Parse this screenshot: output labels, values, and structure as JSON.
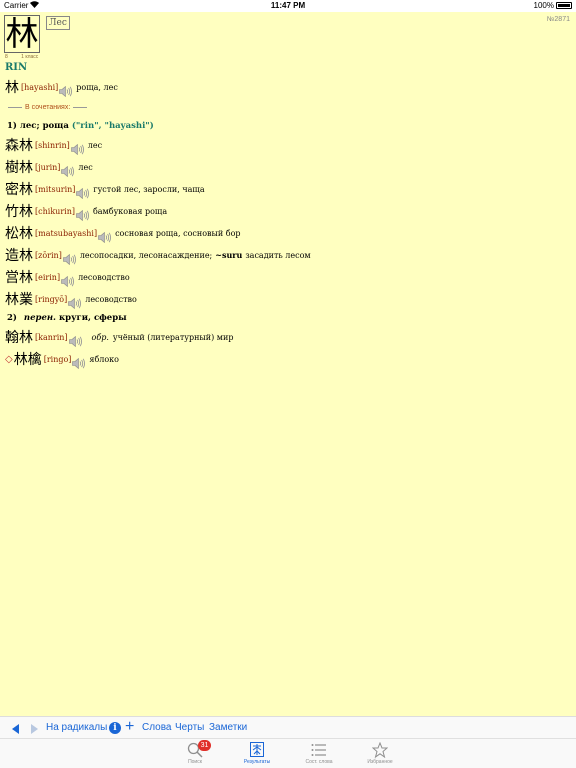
{
  "status_bar": {
    "carrier": "Carrier",
    "time": "11:47 PM",
    "battery": "100%"
  },
  "kanji": {
    "character": "林",
    "meaning": "Лес",
    "strokes": "8",
    "grade": "1 класс",
    "entry_number": "№2871",
    "on_reading": "RIN"
  },
  "main_word": {
    "kanji": "林",
    "reading": "[hayashi]",
    "translation": "роща, лес"
  },
  "combinations_header": "В сочетаниях:",
  "sense1": {
    "label": "1) лес; роща",
    "readings": "(\"rin\", \"hayashi\")"
  },
  "compounds1": [
    {
      "kanji": "森林",
      "reading": "[shinrin]",
      "translation": "лес"
    },
    {
      "kanji": "樹林",
      "reading": "[jurin]",
      "translation": "лес"
    },
    {
      "kanji": "密林",
      "reading": "[mitsurin]",
      "translation": "густой лес, заросли, чаща"
    },
    {
      "kanji": "竹林",
      "reading": "[chikurin]",
      "translation": "бамбуковая роща"
    },
    {
      "kanji": "松林",
      "reading": "[matsubayashi]",
      "translation": "сосновая роща, сосновый бор"
    },
    {
      "kanji": "造林",
      "reading": "[zōrin]",
      "translation": "лесопосадки, лесонасаждение;",
      "suffix": "~suru",
      "suffix_translation": "засадить лесом"
    },
    {
      "kanji": "営林",
      "reading": "[eirin]",
      "translation": "лесоводство"
    },
    {
      "kanji": "林業",
      "reading": "[ringyō]",
      "translation": "лесоводство"
    }
  ],
  "sense2": {
    "number": "2)",
    "abbr": "перен.",
    "label": "круги, сферы"
  },
  "compound2": {
    "kanji": "翰林",
    "reading": "[kanrin]",
    "abbr": "обр.",
    "translation": "учёный (литературный) мир"
  },
  "compound3": {
    "marker": "◇",
    "kanji": "林檎",
    "reading": "[ringo]",
    "translation": "яблоко"
  },
  "toolbar": {
    "radicals": "На радикалы",
    "words": "Слова",
    "strokes": "Черты",
    "notes": "Заметки"
  },
  "tabs": [
    {
      "label": "Поиск",
      "icon": "search-icon",
      "badge": "31"
    },
    {
      "label": "Результаты",
      "icon": "results-icon"
    },
    {
      "label": "Сост. слова",
      "icon": "list-icon"
    },
    {
      "label": "Избранное",
      "icon": "star-icon"
    }
  ],
  "colors": {
    "background": "#ffffc0",
    "reading": "#8b2000",
    "on_reading": "#1a7a6a",
    "accent": "#1a66d6",
    "badge": "#e0302a"
  }
}
